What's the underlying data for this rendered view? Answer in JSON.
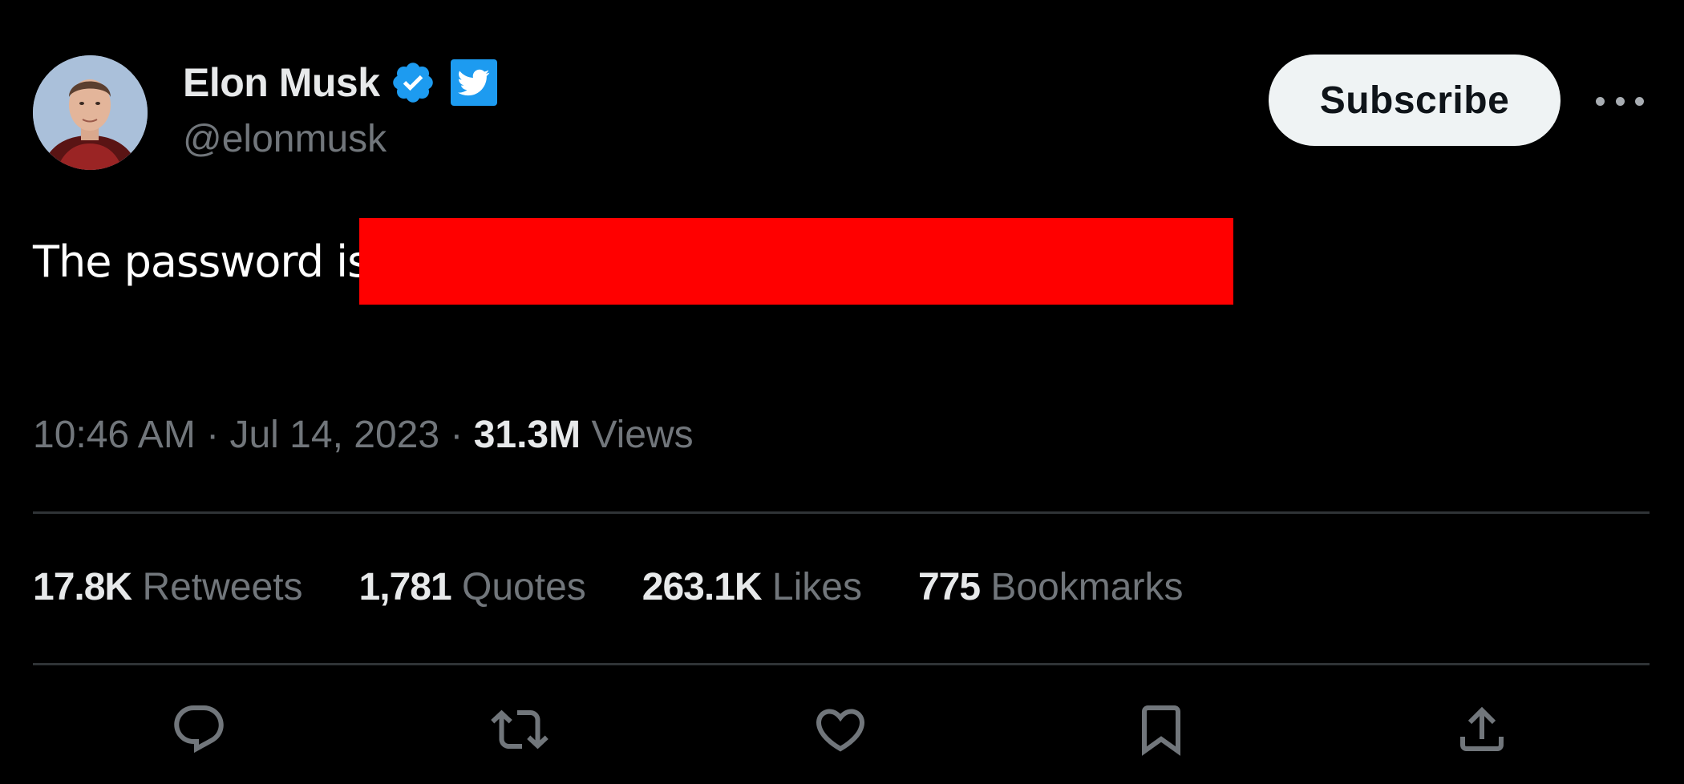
{
  "author": {
    "display_name": "Elon Musk",
    "handle": "@elonmusk",
    "verified_icon": "verified-badge-icon",
    "affiliate_icon": "twitter-bird-icon"
  },
  "header": {
    "subscribe_label": "Subscribe",
    "more_icon": "more-horizontal-icon"
  },
  "tweet": {
    "text": "The password is:",
    "redaction_color": "#ff0000"
  },
  "meta": {
    "time": "10:46 AM",
    "separator": "·",
    "date": "Jul 14, 2023",
    "views_count": "31.3M",
    "views_label": "Views"
  },
  "stats": [
    {
      "count": "17.8K",
      "label": "Retweets"
    },
    {
      "count": "1,781",
      "label": "Quotes"
    },
    {
      "count": "263.1K",
      "label": "Likes"
    },
    {
      "count": "775",
      "label": "Bookmarks"
    }
  ],
  "actions": [
    {
      "icon": "reply-icon"
    },
    {
      "icon": "retweet-icon"
    },
    {
      "icon": "like-icon"
    },
    {
      "icon": "bookmark-icon"
    },
    {
      "icon": "share-icon"
    }
  ],
  "colors": {
    "background": "#000000",
    "primary_text": "#e7e9ea",
    "secondary_text": "#71767b",
    "accent": "#1d9bf0",
    "divider": "#2f3336",
    "subscribe_bg": "#eff3f4"
  }
}
